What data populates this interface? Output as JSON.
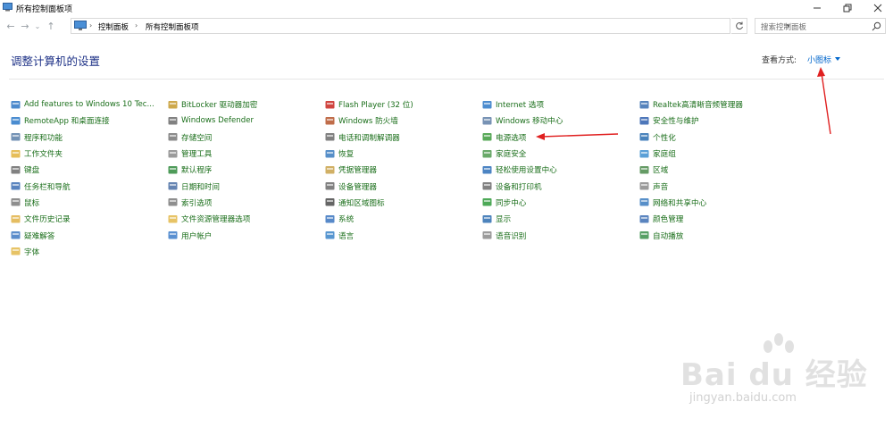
{
  "window": {
    "title": "所有控制面板项",
    "minimize": "minimize",
    "maximize": "maximize",
    "close": "close"
  },
  "address": {
    "crumbs": [
      "控制面板",
      "所有控制面板项"
    ],
    "search_placeholder": "搜索控制面板"
  },
  "header": {
    "title": "调整计算机的设置",
    "view_by_label": "查看方式:",
    "view_by_value": "小图标"
  },
  "columns": [
    [
      {
        "label": "Add features to Windows 10 Tec...",
        "icon": "add-features-icon",
        "color": "#2f77c4"
      },
      {
        "label": "RemoteApp 和桌面连接",
        "icon": "remoteapp-icon",
        "color": "#2a78c8"
      },
      {
        "label": "程序和功能",
        "icon": "programs-icon",
        "color": "#5a7fa8"
      },
      {
        "label": "工作文件夹",
        "icon": "work-folders-icon",
        "color": "#e2b33d"
      },
      {
        "label": "键盘",
        "icon": "keyboard-icon",
        "color": "#6b6b6b"
      },
      {
        "label": "任务栏和导航",
        "icon": "taskbar-icon",
        "color": "#3d6fb4"
      },
      {
        "label": "鼠标",
        "icon": "mouse-icon",
        "color": "#7a7a7a"
      },
      {
        "label": "文件历史记录",
        "icon": "file-history-icon",
        "color": "#e0b245"
      },
      {
        "label": "疑难解答",
        "icon": "troubleshoot-icon",
        "color": "#3e79c2"
      },
      {
        "label": "字体",
        "icon": "fonts-icon",
        "color": "#e3b84a"
      }
    ],
    [
      {
        "label": "BitLocker 驱动器加密",
        "icon": "bitlocker-icon",
        "color": "#c59a2e"
      },
      {
        "label": "Windows Defender",
        "icon": "defender-icon",
        "color": "#6b6b6b"
      },
      {
        "label": "存储空间",
        "icon": "storage-icon",
        "color": "#777777"
      },
      {
        "label": "管理工具",
        "icon": "admin-tools-icon",
        "color": "#8a8a8a"
      },
      {
        "label": "默认程序",
        "icon": "default-programs-icon",
        "color": "#2f8a3c"
      },
      {
        "label": "日期和时间",
        "icon": "date-time-icon",
        "color": "#4a6fa5"
      },
      {
        "label": "索引选项",
        "icon": "indexing-icon",
        "color": "#7a7a7a"
      },
      {
        "label": "文件资源管理器选项",
        "icon": "explorer-options-icon",
        "color": "#e3b84a"
      },
      {
        "label": "用户帐户",
        "icon": "user-accounts-icon",
        "color": "#3d7cc9"
      }
    ],
    [
      {
        "label": "Flash Player (32 位)",
        "icon": "flash-icon",
        "color": "#c8261e"
      },
      {
        "label": "Windows 防火墙",
        "icon": "firewall-icon",
        "color": "#b5532a"
      },
      {
        "label": "电话和调制解调器",
        "icon": "phone-modem-icon",
        "color": "#6b6b6b"
      },
      {
        "label": "恢复",
        "icon": "recovery-icon",
        "color": "#3a7bbf"
      },
      {
        "label": "凭据管理器",
        "icon": "credential-icon",
        "color": "#c9a24a"
      },
      {
        "label": "设备管理器",
        "icon": "device-manager-icon",
        "color": "#6b6b6b"
      },
      {
        "label": "通知区域图标",
        "icon": "notification-icon",
        "color": "#4a4a4a"
      },
      {
        "label": "系统",
        "icon": "system-icon",
        "color": "#3a74c0"
      },
      {
        "label": "语言",
        "icon": "language-icon",
        "color": "#3a84c8"
      }
    ],
    [
      {
        "label": "Internet 选项",
        "icon": "internet-options-icon",
        "color": "#2e79c7"
      },
      {
        "label": "Windows 移动中心",
        "icon": "mobility-center-icon",
        "color": "#5f7fa7"
      },
      {
        "label": "电源选项",
        "icon": "power-options-icon",
        "color": "#3c9a3c"
      },
      {
        "label": "家庭安全",
        "icon": "family-safety-icon",
        "color": "#4f9a4f"
      },
      {
        "label": "轻松使用设置中心",
        "icon": "ease-of-access-icon",
        "color": "#2d6fb8"
      },
      {
        "label": "设备和打印机",
        "icon": "devices-printers-icon",
        "color": "#6b6b6b"
      },
      {
        "label": "同步中心",
        "icon": "sync-center-icon",
        "color": "#2e9a3a"
      },
      {
        "label": "显示",
        "icon": "display-icon",
        "color": "#2e6db0"
      },
      {
        "label": "语音识别",
        "icon": "speech-icon",
        "color": "#8a8a8a"
      }
    ],
    [
      {
        "label": "Realtek高清晰音频管理器",
        "icon": "realtek-icon",
        "color": "#3a6fb0"
      },
      {
        "label": "安全性与维护",
        "icon": "security-maintenance-icon",
        "color": "#2f5fae"
      },
      {
        "label": "个性化",
        "icon": "personalization-icon",
        "color": "#2a6db0"
      },
      {
        "label": "家庭组",
        "icon": "homegroup-icon",
        "color": "#3e8fd0"
      },
      {
        "label": "区域",
        "icon": "region-icon",
        "color": "#4a8a4a"
      },
      {
        "label": "声音",
        "icon": "sound-icon",
        "color": "#8a8a8a"
      },
      {
        "label": "网络和共享中心",
        "icon": "network-icon",
        "color": "#3a7bc0"
      },
      {
        "label": "颜色管理",
        "icon": "color-management-icon",
        "color": "#3d6fb4"
      },
      {
        "label": "自动播放",
        "icon": "autoplay-icon",
        "color": "#3a8f4a"
      }
    ]
  ],
  "watermark": {
    "brand": "Bai du 经验",
    "domain": "jingyan.baidu.com"
  },
  "colors": {
    "heading": "#1e3287",
    "link": "#1a6e1a",
    "accent_blue": "#0066cc",
    "annotation_red": "#e02020"
  }
}
